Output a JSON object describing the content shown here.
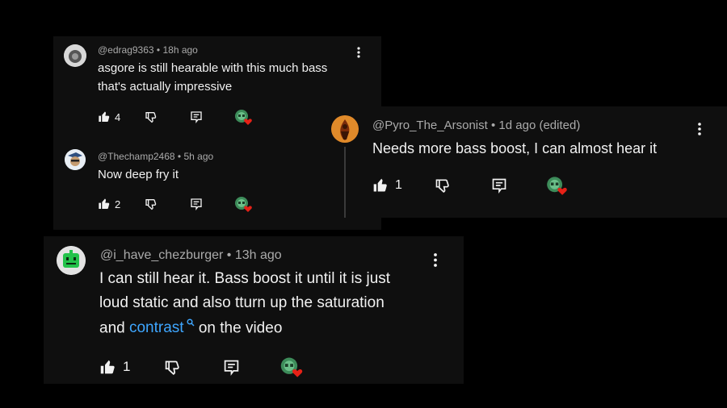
{
  "comments": [
    {
      "username": "@edrag9363",
      "time": "18h ago",
      "lines": [
        "asgore is still hearable with this much bass",
        "that's actually impressive"
      ],
      "likes": "4"
    },
    {
      "username": "@Thechamp2468",
      "time": "5h ago",
      "lines": [
        "Now deep fry  it"
      ],
      "likes": "2"
    },
    {
      "username": "@Pyro_The_Arsonist",
      "time": "1d ago (edited)",
      "lines": [
        "Needs more bass boost, I can almost hear it"
      ],
      "likes": "1"
    },
    {
      "username": "@i_have_chezburger",
      "time": "13h ago",
      "lines": [
        "I can still hear it. Bass boost it until it is just",
        "loud static and also tturn up the saturation"
      ],
      "line3_prefix": "and ",
      "line3_link": "contrast",
      "line3_suffix": " on the video",
      "likes": "1"
    }
  ],
  "separator": "•",
  "icons": [
    "thumbs-up-icon",
    "thumbs-down-icon",
    "reply-icon",
    "creator-heart-icon",
    "more-vert-icon",
    "search-icon"
  ],
  "colors": {
    "link": "#3ea6ff",
    "heart": "#e62117",
    "card": "#0f0f0f",
    "meta": "#aaaaaa"
  }
}
